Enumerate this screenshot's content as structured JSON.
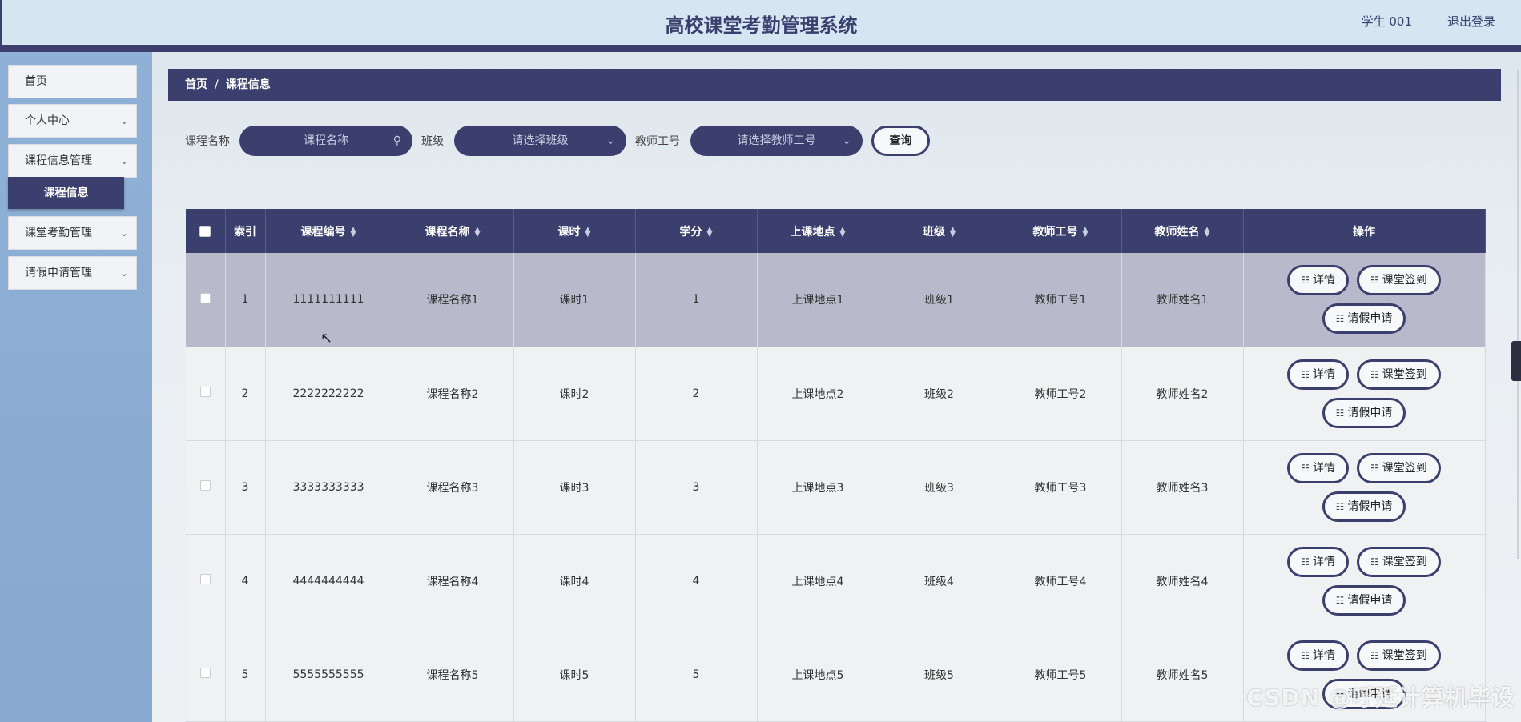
{
  "header": {
    "title": "高校课堂考勤管理系统",
    "user": "学生 001",
    "logout": "退出登录"
  },
  "sidebar": {
    "items": [
      {
        "label": "首页",
        "has_chevron": false
      },
      {
        "label": "个人中心",
        "has_chevron": true
      },
      {
        "label": "课程信息管理",
        "has_chevron": true
      },
      {
        "label": "课堂考勤管理",
        "has_chevron": true
      },
      {
        "label": "请假申请管理",
        "has_chevron": true
      }
    ],
    "active_subitem": "课程信息"
  },
  "breadcrumb": {
    "home": "首页",
    "separator": "/",
    "current": "课程信息"
  },
  "search": {
    "course_name_label": "课程名称",
    "course_name_placeholder": "课程名称",
    "class_label": "班级",
    "class_placeholder": "请选择班级",
    "teacher_id_label": "教师工号",
    "teacher_id_placeholder": "请选择教师工号",
    "query_button": "查询"
  },
  "table": {
    "headers": {
      "index": "索引",
      "course_code": "课程编号",
      "course_name": "课程名称",
      "hours": "课时",
      "credit": "学分",
      "location": "上课地点",
      "class": "班级",
      "teacher_id": "教师工号",
      "teacher_name": "教师姓名",
      "actions": "操作"
    },
    "rows": [
      {
        "index": "1",
        "course_code": "1111111111",
        "course_name": "课程名称1",
        "hours": "课时1",
        "credit": "1",
        "location": "上课地点1",
        "class": "班级1",
        "teacher_id": "教师工号1",
        "teacher_name": "教师姓名1"
      },
      {
        "index": "2",
        "course_code": "2222222222",
        "course_name": "课程名称2",
        "hours": "课时2",
        "credit": "2",
        "location": "上课地点2",
        "class": "班级2",
        "teacher_id": "教师工号2",
        "teacher_name": "教师姓名2"
      },
      {
        "index": "3",
        "course_code": "3333333333",
        "course_name": "课程名称3",
        "hours": "课时3",
        "credit": "3",
        "location": "上课地点3",
        "class": "班级3",
        "teacher_id": "教师工号3",
        "teacher_name": "教师姓名3"
      },
      {
        "index": "4",
        "course_code": "4444444444",
        "course_name": "课程名称4",
        "hours": "课时4",
        "credit": "4",
        "location": "上课地点4",
        "class": "班级4",
        "teacher_id": "教师工号4",
        "teacher_name": "教师姓名4"
      },
      {
        "index": "5",
        "course_code": "5555555555",
        "course_name": "课程名称5",
        "hours": "课时5",
        "credit": "5",
        "location": "上课地点5",
        "class": "班级5",
        "teacher_id": "教师工号5",
        "teacher_name": "教师姓名5"
      }
    ],
    "actions": {
      "detail": "详情",
      "checkin": "课堂签到",
      "leave": "请假申请"
    }
  },
  "watermark": "CSDN @呼延计算机毕设",
  "colors": {
    "accent": "#3a3f6e",
    "header_bg": "#d5e5f2",
    "sidebar_bg": "#8fb1d6",
    "row_selected": "#b8bacb"
  }
}
